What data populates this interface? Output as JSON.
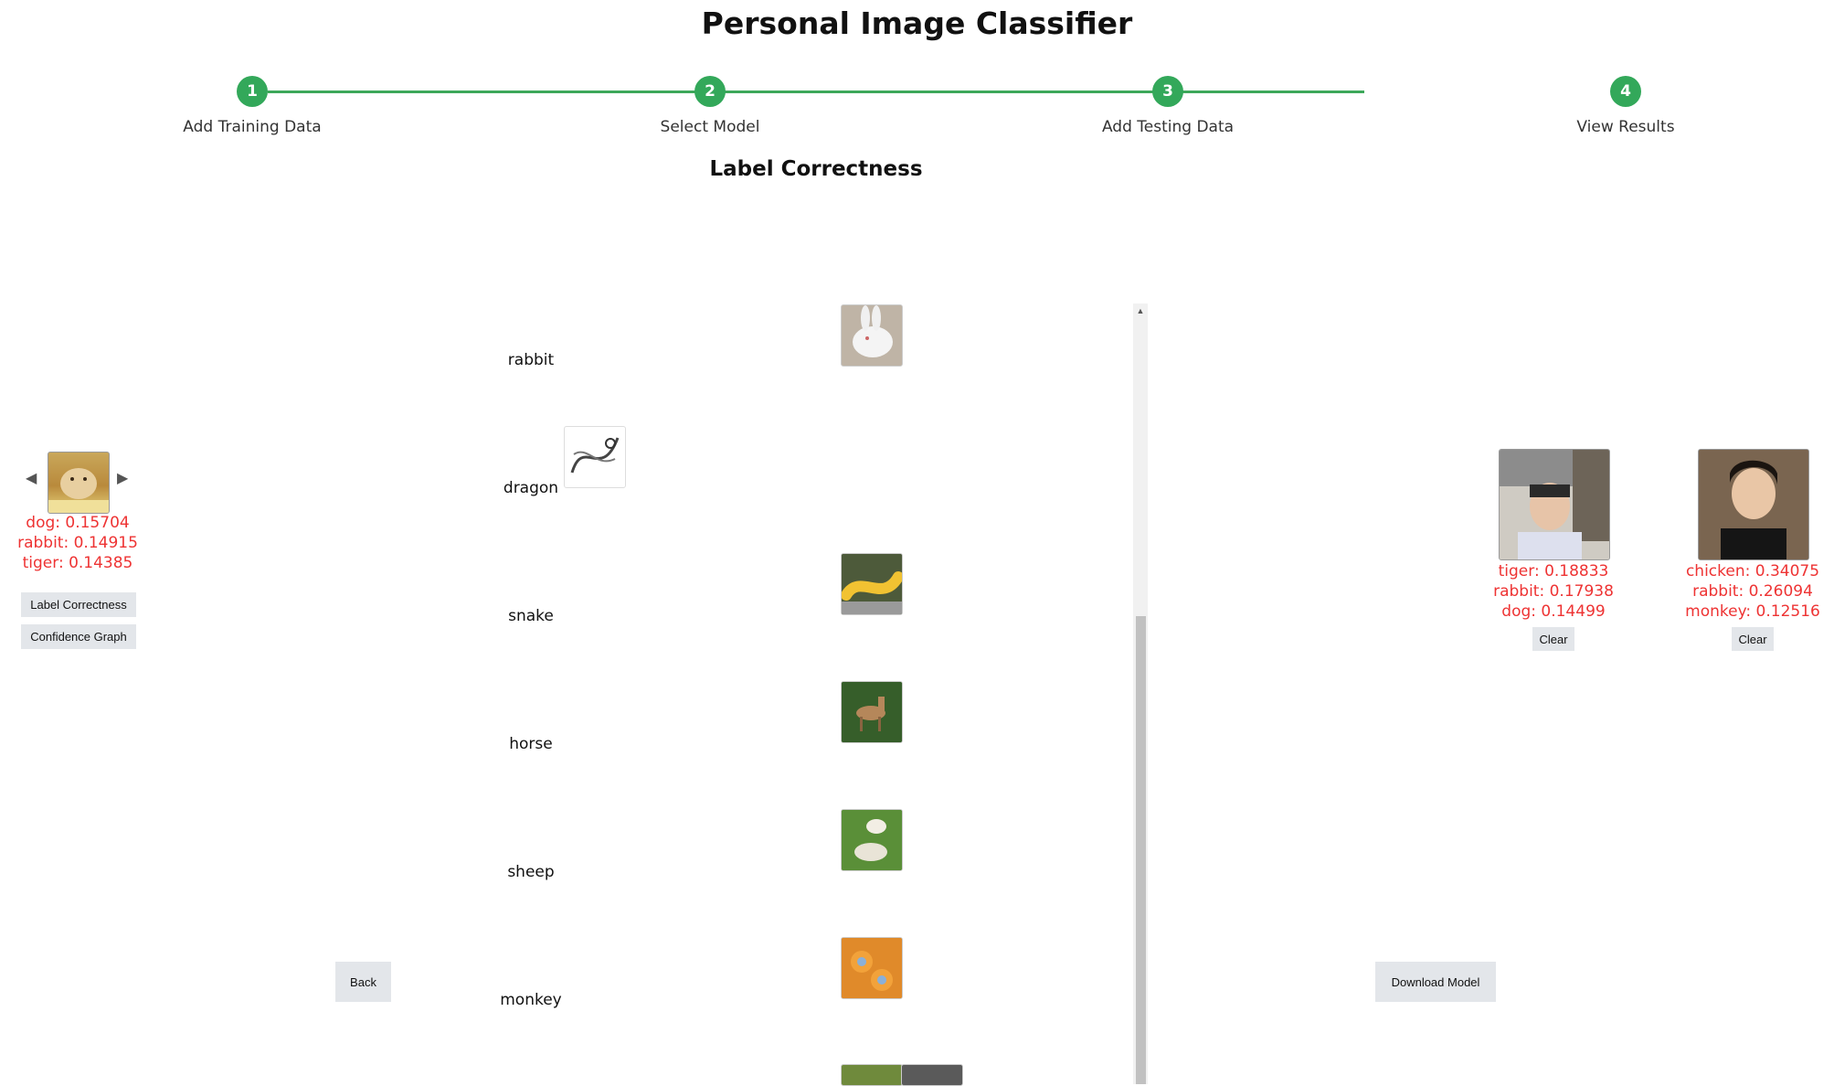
{
  "app": {
    "title": "Personal Image Classifier"
  },
  "steps": [
    {
      "number": "1",
      "label": "Add Training Data"
    },
    {
      "number": "2",
      "label": "Select Model"
    },
    {
      "number": "3",
      "label": "Add Testing Data"
    },
    {
      "number": "4",
      "label": "View Results"
    }
  ],
  "colors": {
    "accent": "#33a85a",
    "prediction": "#ee3333"
  },
  "view": {
    "title": "Label Correctness"
  },
  "current_image": {
    "prev_icon": "triangle-left-icon",
    "next_icon": "triangle-right-icon",
    "predictions": [
      "dog: 0.15704",
      "rabbit: 0.14915",
      "tiger: 0.14385"
    ]
  },
  "view_buttons": {
    "label_correctness": "Label Correctness",
    "confidence_graph": "Confidence Graph"
  },
  "labels": [
    "rabbit",
    "dragon",
    "snake",
    "horse",
    "sheep",
    "monkey"
  ],
  "test_images": [
    {
      "predictions": [
        "tiger: 0.18833",
        "rabbit: 0.17938",
        "dog: 0.14499"
      ],
      "clear_label": "Clear"
    },
    {
      "predictions": [
        "chicken: 0.34075",
        "rabbit: 0.26094",
        "monkey: 0.12516"
      ],
      "clear_label": "Clear"
    }
  ],
  "nav": {
    "back_label": "Back",
    "download_label": "Download Model"
  }
}
